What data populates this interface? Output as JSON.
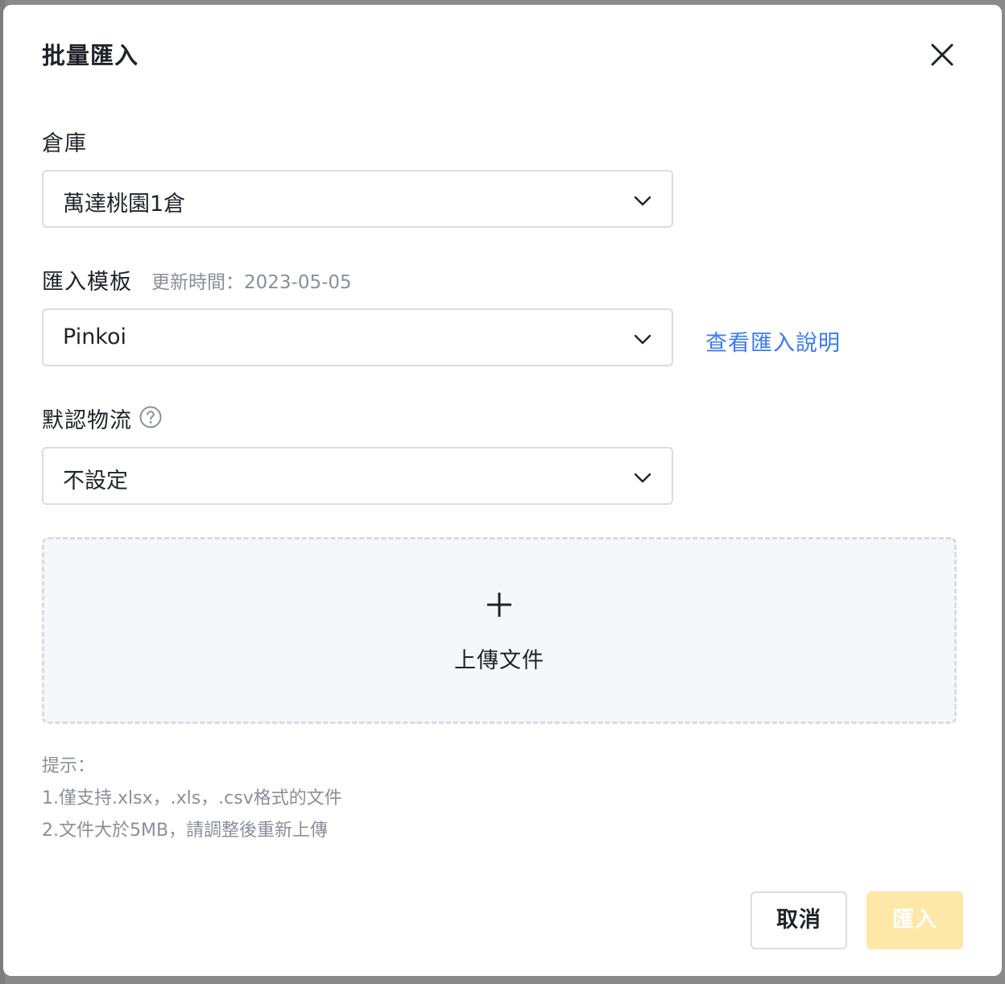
{
  "dialog": {
    "title": "批量匯入",
    "warehouse": {
      "label": "倉庫",
      "selected": "萬達桃園1倉"
    },
    "template": {
      "label": "匯入模板",
      "updated": "更新時間：2023-05-05",
      "selected": "Pinkoi",
      "help_link": "查看匯入說明"
    },
    "logistics": {
      "label": "默認物流",
      "selected": "不設定"
    },
    "upload": {
      "label": "上傳文件"
    },
    "tips": {
      "title": "提示：",
      "line1": "1.僅支持.xlsx，.xls，.csv格式的文件",
      "line2": "2.文件大於5MB，請調整後重新上傳"
    },
    "buttons": {
      "cancel": "取消",
      "import": "匯入"
    }
  },
  "colors": {
    "link": "#3a7bf0",
    "primary_disabled": "#fde8a8",
    "text": "#1f2329",
    "muted": "#8a8f99"
  },
  "icons": [
    "close-icon",
    "chevron-down-icon",
    "help-circle-icon",
    "plus-icon"
  ]
}
